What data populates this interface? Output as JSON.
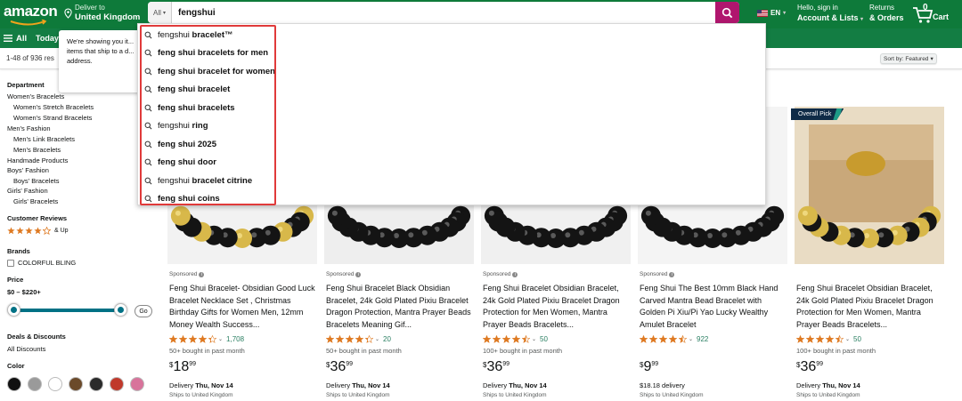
{
  "nav": {
    "logo_text": "amazon",
    "deliver_line1": "Deliver to",
    "deliver_line2": "United Kingdom",
    "search_category": "All",
    "search_value": "fengshui",
    "lang": "EN",
    "account_line1": "Hello, sign in",
    "account_line2": "Account & Lists",
    "returns_line1": "Returns",
    "returns_line2": "& Orders",
    "cart_count": "0",
    "cart_label": "Cart",
    "colors": {
      "nav_bg": "#0e7a3a",
      "search_btn": "#b0166e"
    }
  },
  "subnav": {
    "all_label": "All",
    "today_label": "Today"
  },
  "results": {
    "count_text": "1-48 of 936 res",
    "sort_label": "Sort by:",
    "sort_value": "Featured"
  },
  "popover": {
    "text": "We're showing you it... items that ship to a d... address."
  },
  "autocomplete": {
    "items": [
      {
        "typed": "fengshui",
        "suggest": " bracelet™"
      },
      {
        "typed": "",
        "suggest": "feng shui bracelets for men"
      },
      {
        "typed": "",
        "suggest": "feng shui bracelet for women"
      },
      {
        "typed": "",
        "suggest": "feng shui bracelet"
      },
      {
        "typed": "",
        "suggest": "feng shui bracelets"
      },
      {
        "typed": "fengshui",
        "suggest": " ring"
      },
      {
        "typed": "",
        "suggest": "feng shui 2025"
      },
      {
        "typed": "",
        "suggest": "feng shui door"
      },
      {
        "typed": "fengshui",
        "suggest": " bracelet citrine"
      },
      {
        "typed": "",
        "suggest": "feng shui coins"
      }
    ]
  },
  "sidebar": {
    "department_head": "Department",
    "departments": [
      "Women's Bracelets",
      "Women's Stretch Bracelets",
      "Women's Strand Bracelets",
      "Men's Fashion",
      "Men's Link Bracelets",
      "Men's Bracelets",
      "Handmade Products",
      "Boys' Fashion",
      "Boys' Bracelets",
      "Girls' Fashion",
      "Girls' Bracelets"
    ],
    "reviews_head": "Customer Reviews",
    "reviews_up": "& Up",
    "brands_head": "Brands",
    "brand_item": "COLORFUL BLING",
    "price_head": "Price",
    "price_range": "$0 – $220+",
    "go_label": "Go",
    "deals_head": "Deals & Discounts",
    "deals_item": "All Discounts",
    "color_head": "Color",
    "swatch_colors": [
      "#111111",
      "#9a9a9a",
      "#ffffff",
      "#6b4a2a",
      "#2a2a2a",
      "#c0392b",
      "#d8739b"
    ]
  },
  "overall_pick": "Overall Pick",
  "products": [
    {
      "sponsored": "Sponsored",
      "title": "Feng Shui Bracelet- Obsidian Good Luck Bracelet Necklace Set , Christmas Birthday Gifts for Women Men, 12mm Money Wealth Success...",
      "rating": 4.3,
      "reviews": "1,708",
      "bought": "50+ bought in past month",
      "price_whole": "18",
      "price_frac": "99",
      "delivery_prefix": "Delivery ",
      "delivery_date": "Thu, Nov 14",
      "ships": "Ships to United Kingdom"
    },
    {
      "sponsored": "Sponsored",
      "title": "Feng Shui Bracelet Black Obsidian Bracelet, 24k Gold Plated Pixiu Bracelet Dragon Protection, Mantra Prayer Beads Bracelets Meaning Gif...",
      "rating": 4.3,
      "reviews": "20",
      "bought": "50+ bought in past month",
      "price_whole": "36",
      "price_frac": "99",
      "delivery_prefix": "Delivery ",
      "delivery_date": "Thu, Nov 14",
      "ships": "Ships to United Kingdom"
    },
    {
      "sponsored": "Sponsored",
      "title": "Feng Shui Bracelet Obsidian Bracelet, 24k Gold Plated Pixiu Bracelet Dragon Protection for Men Women, Mantra Prayer Beads Bracelets...",
      "rating": 4.5,
      "reviews": "50",
      "bought": "100+ bought in past month",
      "price_whole": "36",
      "price_frac": "99",
      "delivery_prefix": "Delivery ",
      "delivery_date": "Thu, Nov 14",
      "ships": "Ships to United Kingdom"
    },
    {
      "sponsored": "Sponsored",
      "title": "Feng Shui The Best 10mm Black Hand Carved Mantra Bead Bracelet with Golden Pi Xiu/Pi Yao Lucky Wealthy Amulet Bracelet",
      "rating": 4.5,
      "reviews": "922",
      "bought": "",
      "price_whole": "9",
      "price_frac": "99",
      "delivery_prefix": "$18.18 delivery",
      "delivery_date": "",
      "ships": "Ships to United Kingdom"
    },
    {
      "sponsored": "",
      "title": "Feng Shui Bracelet Obsidian Bracelet, 24k Gold Plated Pixiu Bracelet Dragon Protection for Men Women, Mantra Prayer Beads Bracelets...",
      "rating": 4.5,
      "reviews": "50",
      "bought": "100+ bought in past month",
      "price_whole": "36",
      "price_frac": "99",
      "delivery_prefix": "Delivery ",
      "delivery_date": "Thu, Nov 14",
      "ships": "Ships to United Kingdom"
    }
  ],
  "price_symbol": "$"
}
